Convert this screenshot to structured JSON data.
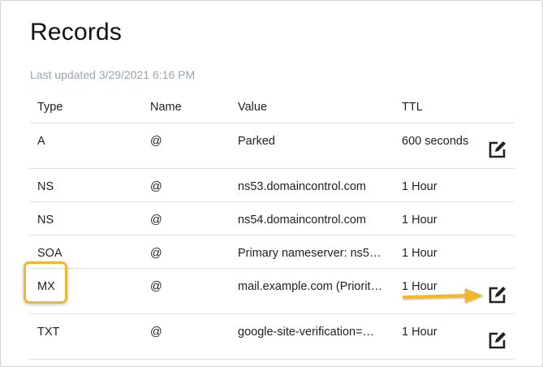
{
  "page": {
    "title": "Records",
    "last_updated": "Last updated 3/29/2021 6:16 PM"
  },
  "table": {
    "columns": [
      "Type",
      "Name",
      "Value",
      "TTL"
    ],
    "rows": [
      {
        "type": "A",
        "name": "@",
        "value": "Parked",
        "ttl": "600 seconds",
        "editable": true
      },
      {
        "type": "NS",
        "name": "@",
        "value": "ns53.domaincontrol.com",
        "ttl": "1 Hour",
        "editable": false
      },
      {
        "type": "NS",
        "name": "@",
        "value": "ns54.domaincontrol.com",
        "ttl": "1 Hour",
        "editable": false
      },
      {
        "type": "SOA",
        "name": "@",
        "value": "Primary nameserver: ns5…",
        "ttl": "1 Hour",
        "editable": false
      },
      {
        "type": "MX",
        "name": "@",
        "value": "mail.example.com (Priorit…",
        "ttl": "1 Hour",
        "editable": true
      },
      {
        "type": "TXT",
        "name": "@",
        "value": "google-site-verification=…",
        "ttl": "1 Hour",
        "editable": true
      }
    ]
  },
  "annotations": {
    "highlight_color": "#f2b82c",
    "arrow_color": "#f2b82c",
    "icon": "edit-icon"
  }
}
